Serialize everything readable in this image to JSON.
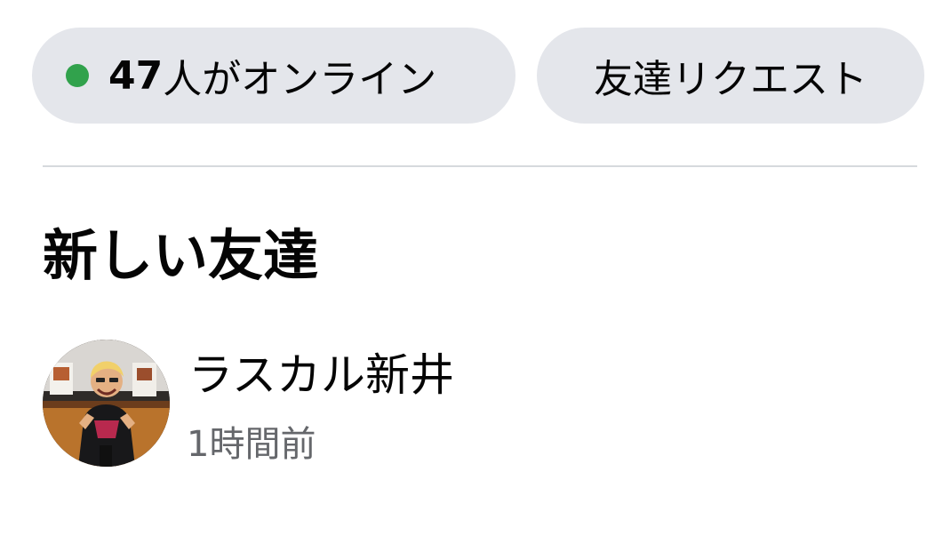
{
  "status_chips": {
    "online_count": "47",
    "online_suffix": "人がオンライン",
    "friend_requests_label": "友達リクエスト"
  },
  "new_friends": {
    "title": "新しい友達",
    "items": [
      {
        "name": "ラスカル新井",
        "time": "1時間前",
        "avatar_icon": "profile-photo"
      }
    ]
  },
  "colors": {
    "chip_background": "#e4e6eb",
    "online_dot": "#31a24c",
    "primary_text": "#050505",
    "secondary_text": "#65676b",
    "divider": "#d6d9dd"
  }
}
